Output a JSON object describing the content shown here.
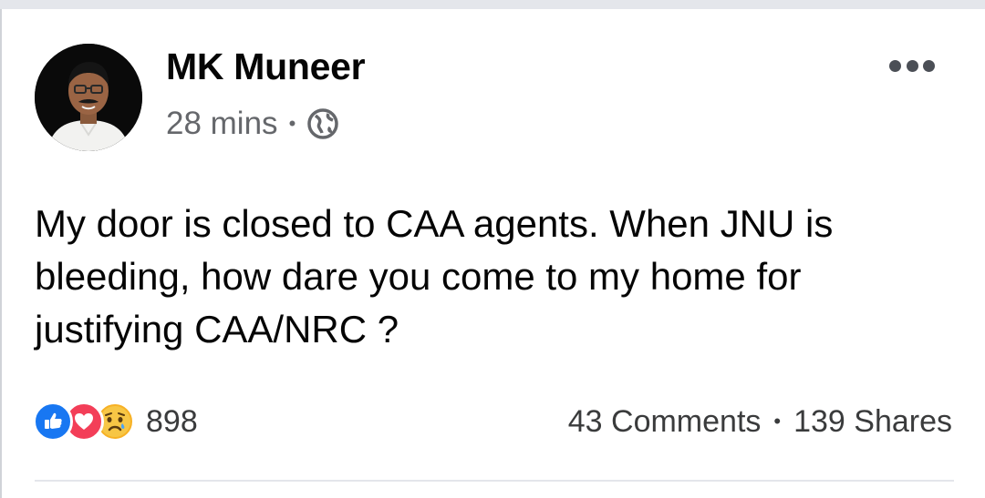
{
  "post": {
    "author": "MK Muneer",
    "timestamp": "28 mins",
    "meta_separator": "•",
    "privacy_icon": "globe-icon",
    "more_icon": "more-options-icon",
    "text": "My door is closed to CAA agents. When JNU is bleeding, how dare you come to my home for justifying CAA/NRC ?"
  },
  "reactions": {
    "icons": [
      "like-icon",
      "love-icon",
      "sad-icon"
    ],
    "count": "898"
  },
  "stats": {
    "comments": "43 Comments",
    "separator": "•",
    "shares": "139 Shares"
  },
  "colors": {
    "like": "#1877f2",
    "love": "#f33e58",
    "sad": "#f7b125",
    "text_primary": "#050505",
    "text_secondary": "#65676b"
  }
}
